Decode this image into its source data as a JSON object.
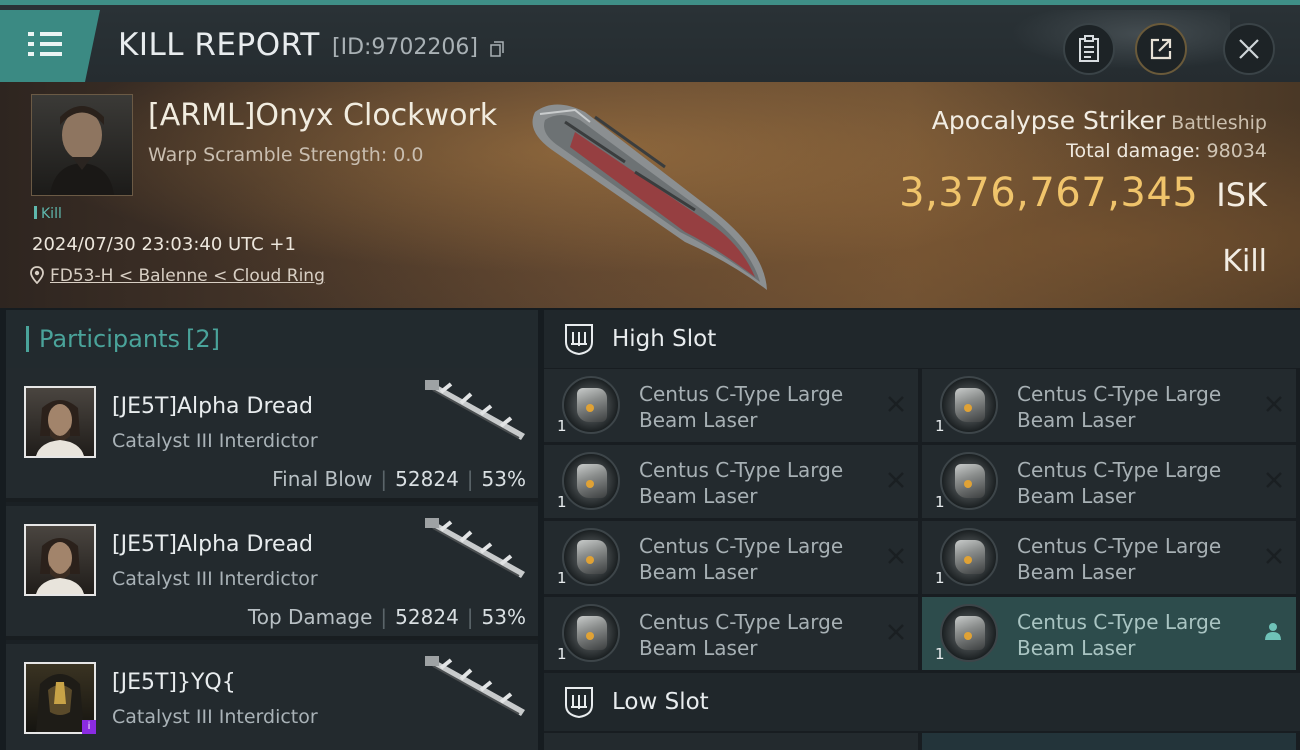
{
  "header": {
    "title": "KILL REPORT",
    "report_id": "[ID:9702206]",
    "icons": [
      "menu-icon",
      "copy-icon",
      "clipboard-icon",
      "share-icon",
      "close-icon"
    ]
  },
  "victim": {
    "pilot_name": "[ARML]Onyx Clockwork",
    "warp_scramble": "Warp Scramble Strength: 0.0",
    "tag": "Kill",
    "datetime": "2024/07/30 23:03:40 UTC +1",
    "location": "FD53-H < Balenne < Cloud Ring",
    "ship_name": "Apocalypse Striker",
    "ship_class": "Battleship",
    "total_damage_label": "Total damage:",
    "total_damage_value": "98034",
    "isk_value": "3,376,767,345",
    "isk_unit": "ISK",
    "result": "Kill"
  },
  "participants": {
    "title": "Participants",
    "count": "[2]",
    "items": [
      {
        "name": "[JE5T]Alpha Dread",
        "ship": "Catalyst III Interdictor",
        "label": "Final Blow",
        "damage": "52824",
        "percent": "53%"
      },
      {
        "name": "[JE5T]Alpha Dread",
        "ship": "Catalyst III Interdictor",
        "label": "Top Damage",
        "damage": "52824",
        "percent": "53%"
      },
      {
        "name": "[JE5T]}YQ{",
        "ship": "Catalyst III Interdictor",
        "label": "",
        "damage": "",
        "percent": ""
      }
    ]
  },
  "slots": {
    "high_label": "High Slot",
    "low_label": "Low Slot",
    "high_modules": [
      {
        "name_line1": "Centus C-Type Large",
        "name_line2": "Beam Laser",
        "qty": "1",
        "state": "destroyed"
      },
      {
        "name_line1": "Centus C-Type Large",
        "name_line2": "Beam Laser",
        "qty": "1",
        "state": "destroyed"
      },
      {
        "name_line1": "Centus C-Type Large",
        "name_line2": "Beam Laser",
        "qty": "1",
        "state": "destroyed"
      },
      {
        "name_line1": "Centus C-Type Large",
        "name_line2": "Beam Laser",
        "qty": "1",
        "state": "destroyed"
      },
      {
        "name_line1": "Centus C-Type Large",
        "name_line2": "Beam Laser",
        "qty": "1",
        "state": "destroyed"
      },
      {
        "name_line1": "Centus C-Type Large",
        "name_line2": "Beam Laser",
        "qty": "1",
        "state": "destroyed"
      },
      {
        "name_line1": "Centus C-Type Large",
        "name_line2": "Beam Laser",
        "qty": "1",
        "state": "destroyed"
      },
      {
        "name_line1": "Centus C-Type Large",
        "name_line2": "Beam Laser",
        "qty": "1",
        "state": "dropped"
      }
    ]
  },
  "colors": {
    "accent_teal": "#3b8a83",
    "isk_gold": "#f0c46b",
    "selected_module": "#2d4c4c"
  }
}
